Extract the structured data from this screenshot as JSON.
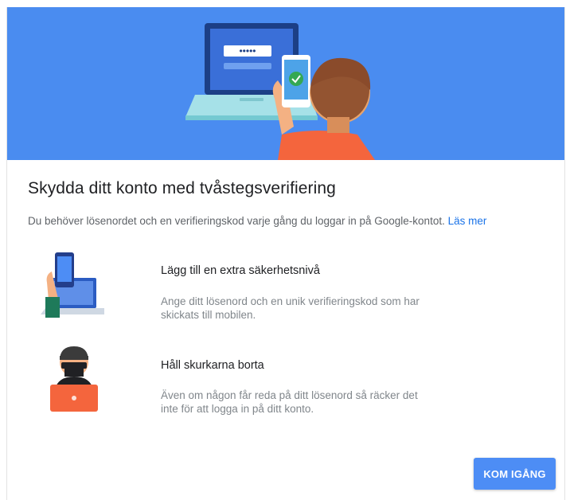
{
  "header": {
    "illustration": "laptop-phone-person-illustration",
    "password_dots": "•••••",
    "accent_color": "#4a8cf0"
  },
  "title": "Skydda ditt konto med tvåstegsverifiering",
  "intro": {
    "text": "Du behöver lösenordet och en verifieringskod varje gång du loggar in på Google-kontot.",
    "link_label": "Läs mer"
  },
  "features": [
    {
      "icon": "phone-laptop-icon",
      "title": "Lägg till en extra säkerhetsnivå",
      "line1": "Ange ditt lösenord och en unik verifieringskod som har",
      "line2": "skickats till mobilen."
    },
    {
      "icon": "burglar-icon",
      "title": "Håll skurkarna borta",
      "line1": "Även om någon får reda på ditt lösenord så räcker det",
      "line2": "inte för att logga in på ditt konto."
    }
  ],
  "actions": {
    "get_started_label": "KOM IGÅNG",
    "button_color": "#4d8df5"
  }
}
